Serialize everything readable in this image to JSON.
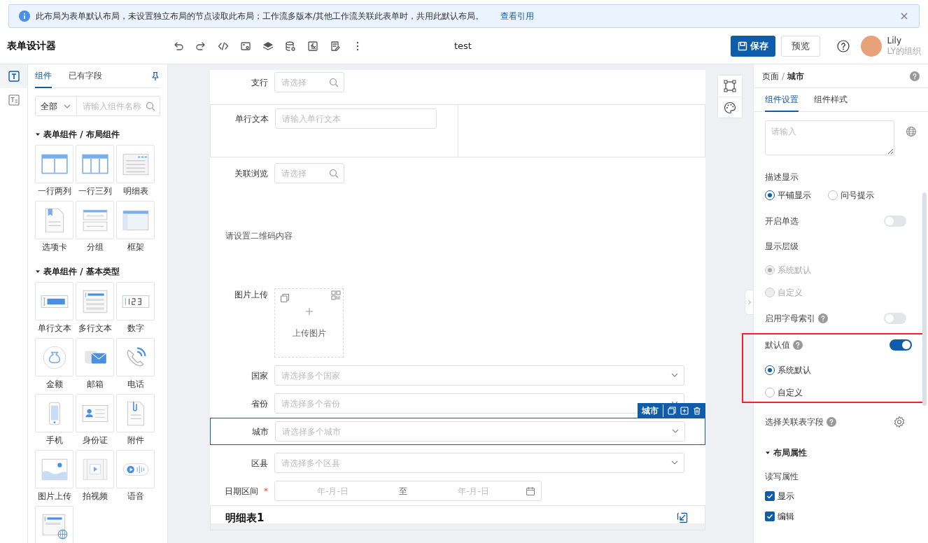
{
  "alert": {
    "text": "此布局为表单默认布局，未设置独立布局的节点读取此布局；工作流多版本/其他工作流关联此表单时，共用此默认布局。",
    "link": "查看引用"
  },
  "header": {
    "title": "表单设计器",
    "doc_name": "test",
    "save": "保存",
    "preview": "预览",
    "user": {
      "name": "Lily",
      "org": "LY的组织"
    }
  },
  "rail": [
    {
      "selected": true
    },
    {
      "selected": false
    }
  ],
  "components": {
    "tabs": [
      {
        "label": "组件",
        "selected": true
      },
      {
        "label": "已有字段",
        "selected": false
      }
    ],
    "filter": "全部",
    "search": {
      "placeholder": "请输入组件名称"
    },
    "groups": [
      {
        "title": "表单组件 / 布局组件",
        "expanded": true,
        "items": [
          {
            "kind": "labeled",
            "label": "一行两列"
          },
          {
            "kind": "labeled",
            "label": "一行三列"
          },
          {
            "kind": "labeled",
            "label": "明细表"
          },
          {
            "kind": "labeled",
            "label": "选项卡"
          },
          {
            "kind": "labeled",
            "label": "分组"
          },
          {
            "kind": "labeled",
            "label": "框架"
          }
        ]
      },
      {
        "title": "表单组件 / 基本类型",
        "expanded": true,
        "items": [
          {
            "kind": "labeled",
            "label": "单行文本"
          },
          {
            "kind": "labeled",
            "label": "多行文本"
          },
          {
            "kind": "labeled",
            "label": "数字"
          },
          {
            "kind": "labeled",
            "label": "金额"
          },
          {
            "kind": "labeled",
            "label": "邮箱"
          },
          {
            "kind": "labeled",
            "label": "电话"
          },
          {
            "kind": "labeled",
            "label": "手机"
          },
          {
            "kind": "labeled",
            "label": "身份证"
          },
          {
            "kind": "labeled",
            "label": "附件"
          },
          {
            "kind": "labeled",
            "label": "图片上传"
          },
          {
            "kind": "labeled",
            "label": "拍视频"
          },
          {
            "kind": "labeled",
            "label": "语音"
          },
          {
            "kind": "unlabeled"
          }
        ]
      }
    ]
  },
  "form": {
    "rows": [
      {
        "kind": "search_select",
        "label": "支行",
        "placeholder": "请选择",
        "selected": false
      },
      {
        "kind": "grid",
        "selected": false,
        "cells": [
          {
            "kind": "text",
            "label": "单行文本",
            "placeholder": "请输入单行文本"
          },
          {
            "kind": "empty"
          }
        ]
      },
      {
        "kind": "search_select",
        "label": "关联浏览",
        "placeholder": "请选择",
        "selected": false
      },
      {
        "kind": "qrcode",
        "text": "请设置二维码内容",
        "selected": false
      },
      {
        "kind": "upload",
        "label": "图片上传",
        "button": "上传图片",
        "selected": false
      },
      {
        "kind": "select",
        "label": "国家",
        "placeholder": "请选择多个国家",
        "selected": false
      },
      {
        "kind": "select",
        "label": "省份",
        "placeholder": "请选择多个省份",
        "selected": false
      },
      {
        "kind": "select",
        "label": "城市",
        "placeholder": "请选择多个城市",
        "selected": true,
        "tag": "城市"
      },
      {
        "kind": "select",
        "label": "区县",
        "placeholder": "请选择多个区县",
        "selected": false
      },
      {
        "kind": "date_range",
        "label": "日期区间",
        "required_mark": "*",
        "start": {
          "placeholder": "年-月-日"
        },
        "separator": "至",
        "end": {
          "placeholder": "年-月-日"
        },
        "selected": false
      },
      {
        "kind": "detail_table",
        "title": "明细表1",
        "selected": false
      }
    ]
  },
  "properties": {
    "breadcrumb": {
      "parent": "页面",
      "separator": "/",
      "current": "城市"
    },
    "tabs": [
      {
        "label": "组件设置",
        "selected": true
      },
      {
        "label": "组件样式",
        "selected": false
      }
    ],
    "description": {
      "placeholder": "请输入"
    },
    "settings": [
      {
        "kind": "radio_row",
        "label": "描述显示",
        "options": [
          {
            "label": "平铺显示",
            "selected": true,
            "disabled": false
          },
          {
            "label": "问号提示",
            "selected": false,
            "disabled": false
          }
        ]
      },
      {
        "kind": "switch",
        "label": "开启单选",
        "help": false,
        "on": false,
        "highlighted": false
      },
      {
        "kind": "radio_group",
        "label": "显示层级",
        "options": [
          {
            "label": "系统默认",
            "selected": true,
            "disabled": true
          },
          {
            "label": "自定义",
            "selected": false,
            "disabled": true
          }
        ]
      },
      {
        "kind": "switch",
        "label": "启用字母索引",
        "help": true,
        "on": false,
        "highlighted": false
      },
      {
        "kind": "switch",
        "label": "默认值",
        "help": true,
        "on": true,
        "highlighted": true,
        "options": [
          {
            "label": "系统默认",
            "selected": true,
            "disabled": false
          },
          {
            "label": "自定义",
            "selected": false,
            "disabled": false
          }
        ]
      },
      {
        "kind": "field_picker",
        "label": "选择关联表字段",
        "help": true
      },
      {
        "kind": "section",
        "title": "布局属性",
        "expanded": true
      },
      {
        "kind": "label",
        "text": "读写属性"
      },
      {
        "kind": "checkbox",
        "label": "显示",
        "checked": true
      },
      {
        "kind": "checkbox",
        "label": "编辑",
        "checked": true
      }
    ]
  }
}
